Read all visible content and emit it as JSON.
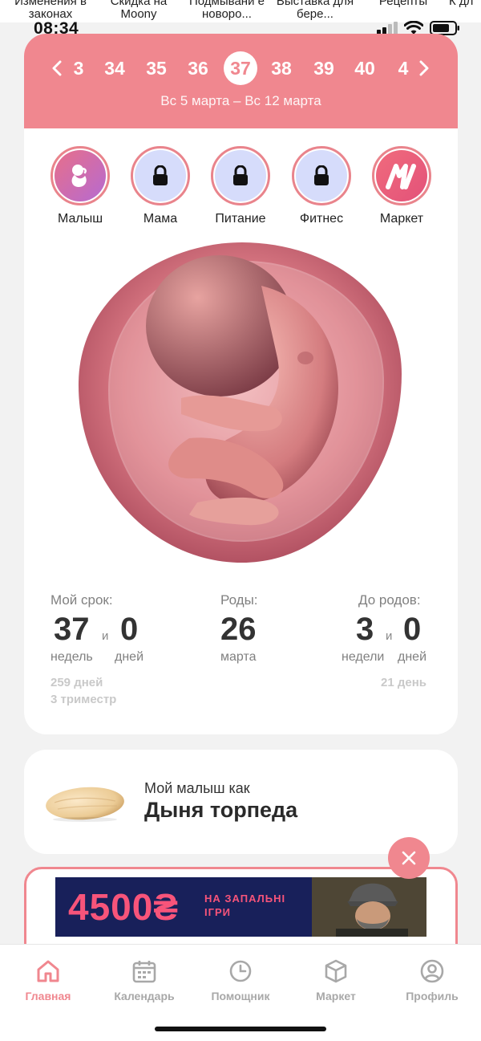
{
  "stories": [
    "Изменения в законах",
    "Скидка на Moony",
    "Подмывани е новоро...",
    "Выставка для бере...",
    "Рецепты",
    "К дл"
  ],
  "status": {
    "time": "08:34"
  },
  "weeks": {
    "items": [
      "3",
      "34",
      "35",
      "36",
      "37",
      "38",
      "39",
      "40",
      "4"
    ],
    "selected": "37",
    "date_range": "Вс 5 марта – Вс 12 марта"
  },
  "categories": [
    {
      "label": "Малыш",
      "icon": "baby-icon",
      "locked": false
    },
    {
      "label": "Мама",
      "icon": "lock-icon",
      "locked": true
    },
    {
      "label": "Питание",
      "icon": "lock-icon",
      "locked": true
    },
    {
      "label": "Фитнес",
      "icon": "lock-icon",
      "locked": true
    },
    {
      "label": "Маркет",
      "icon": "market-logo-icon",
      "locked": false
    }
  ],
  "stats": {
    "term": {
      "label": "Мой срок:",
      "weeks": "37",
      "and": "и",
      "days": "0",
      "weeks_unit": "недель",
      "days_unit": "дней",
      "total_days": "259 дней",
      "trimester": "3 триместр"
    },
    "birth": {
      "label": "Роды:",
      "day": "26",
      "month": "марта"
    },
    "left": {
      "label": "До родов:",
      "weeks": "3",
      "and": "и",
      "days": "0",
      "weeks_unit": "недели",
      "days_unit": "дней",
      "total": "21 день"
    }
  },
  "melon": {
    "prefix": "Мой малыш как",
    "name": "Дыня торпеда"
  },
  "ad": {
    "amount": "4500₴",
    "line1": "НА ЗАПАЛЬНІ",
    "line2": "ІГРИ"
  },
  "tabs": [
    {
      "label": "Главная",
      "icon": "home-icon",
      "active": true
    },
    {
      "label": "Календарь",
      "icon": "calendar-icon",
      "active": false
    },
    {
      "label": "Помощник",
      "icon": "clock-icon",
      "active": false
    },
    {
      "label": "Маркет",
      "icon": "box-icon",
      "active": false
    },
    {
      "label": "Профиль",
      "icon": "profile-icon",
      "active": false
    }
  ],
  "colors": {
    "accent": "#f0878f",
    "ad_bg": "#18205a",
    "ad_text": "#f7547a"
  }
}
